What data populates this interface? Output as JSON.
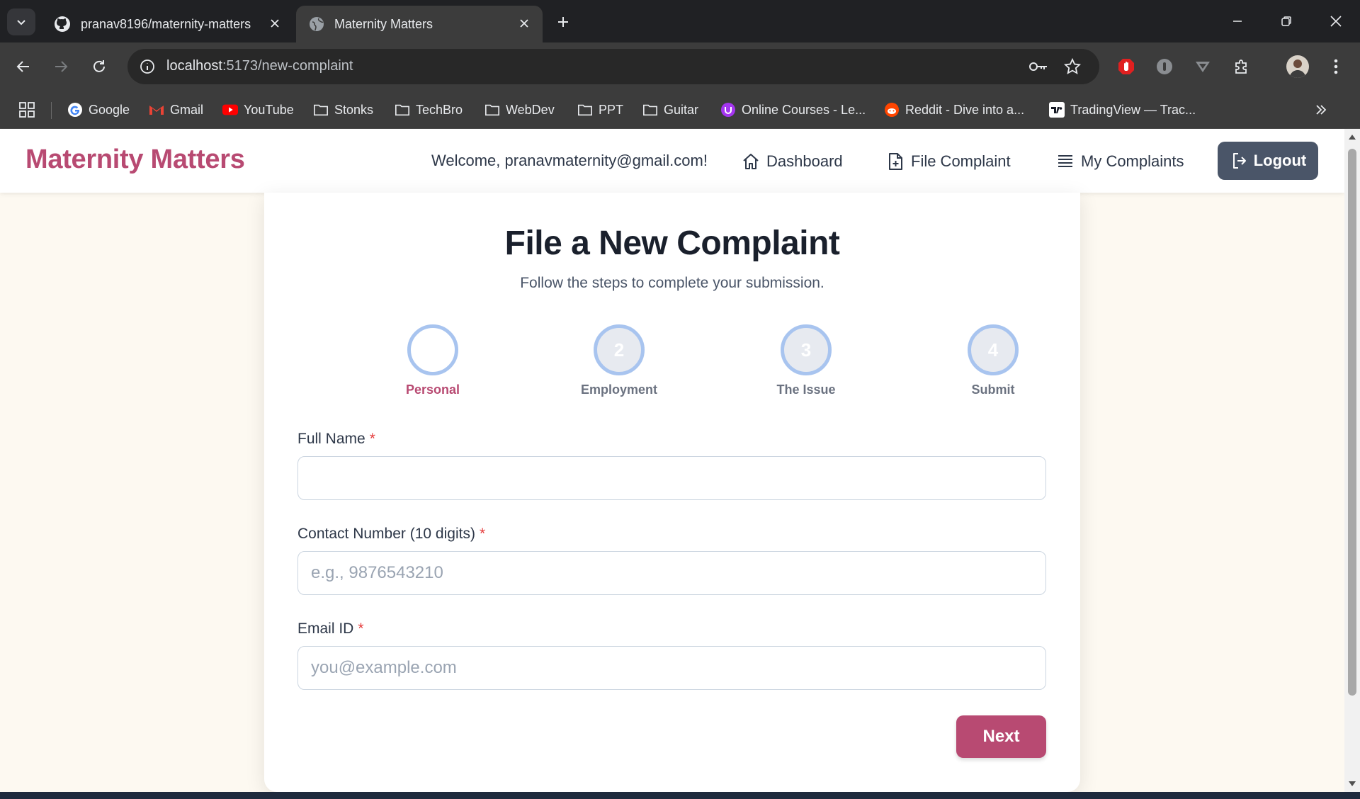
{
  "browser": {
    "tabs": [
      {
        "title": "pranav8196/maternity-matters",
        "icon": "github-icon",
        "active": false
      },
      {
        "title": "Maternity Matters",
        "icon": "globe-icon",
        "active": true
      }
    ],
    "url_host": "localhost",
    "url_path": ":5173/new-complaint",
    "bookmarks": [
      {
        "label": "Google",
        "icon": "google-icon"
      },
      {
        "label": "Gmail",
        "icon": "gmail-icon"
      },
      {
        "label": "YouTube",
        "icon": "youtube-icon"
      },
      {
        "label": "Stonks",
        "icon": "folder-icon"
      },
      {
        "label": "TechBro",
        "icon": "folder-icon"
      },
      {
        "label": "WebDev",
        "icon": "folder-icon"
      },
      {
        "label": "PPT",
        "icon": "folder-icon"
      },
      {
        "label": "Guitar",
        "icon": "folder-icon"
      },
      {
        "label": "Online Courses - Le...",
        "icon": "udemy-icon"
      },
      {
        "label": "Reddit - Dive into a...",
        "icon": "reddit-icon"
      },
      {
        "label": "TradingView — Trac...",
        "icon": "tradingview-icon"
      }
    ]
  },
  "app": {
    "brand": "Maternity Matters",
    "welcome": "Welcome, pranavmaternity@gmail.com!",
    "nav": {
      "dashboard": "Dashboard",
      "file_complaint": "File Complaint",
      "my_complaints": "My Complaints",
      "logout": "Logout"
    },
    "colors": {
      "brand": "#b84a72",
      "logout_bg": "#4a5568",
      "step_ring": "#a8c4ef"
    }
  },
  "form": {
    "title": "File a New Complaint",
    "subtitle": "Follow the steps to complete your submission.",
    "steps": [
      {
        "number": "",
        "label": "Personal",
        "active": true
      },
      {
        "number": "2",
        "label": "Employment",
        "active": false
      },
      {
        "number": "3",
        "label": "The Issue",
        "active": false
      },
      {
        "number": "4",
        "label": "Submit",
        "active": false
      }
    ],
    "fields": {
      "full_name": {
        "label": "Full Name",
        "required": "*",
        "value": "",
        "placeholder": ""
      },
      "contact": {
        "label": "Contact Number (10 digits)",
        "required": "*",
        "value": "",
        "placeholder": "e.g., 9876543210"
      },
      "email": {
        "label": "Email ID",
        "required": "*",
        "value": "",
        "placeholder": "you@example.com"
      }
    },
    "next_label": "Next"
  }
}
